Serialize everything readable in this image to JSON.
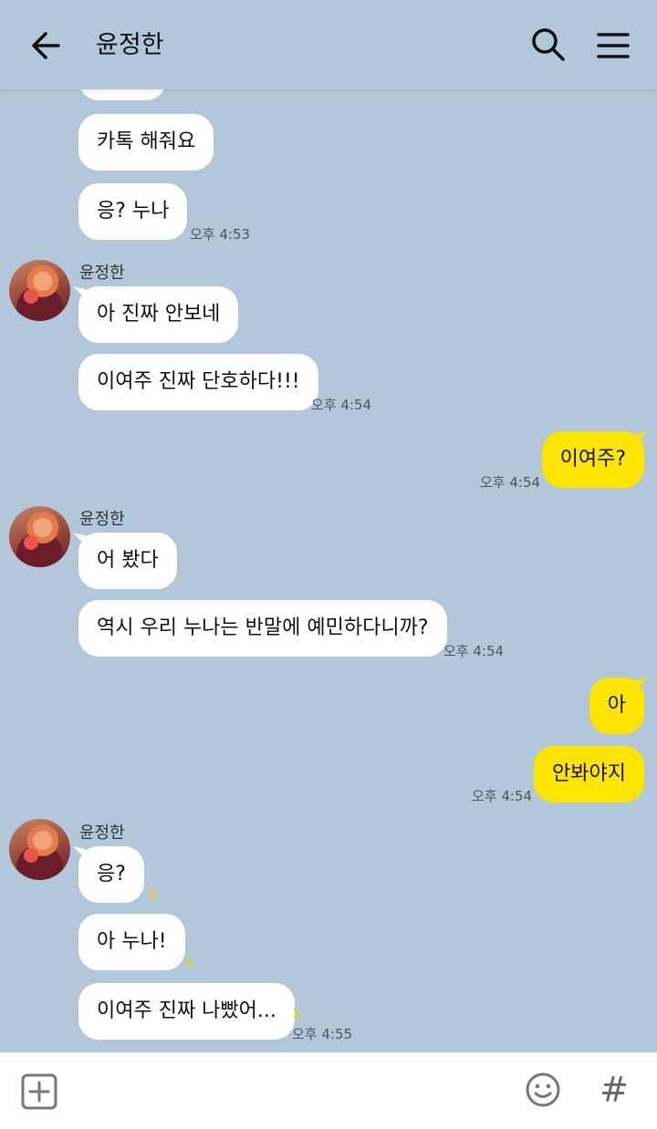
{
  "header": {
    "title": "윤정한"
  },
  "icons": {
    "back": "arrow-left-icon",
    "search": "search-icon",
    "menu": "hamburger-menu-icon",
    "add": "plus-square-icon",
    "emoji": "smiley-icon",
    "hashtag": "hash-icon"
  },
  "colors": {
    "background": "#b2c7d9",
    "incoming": "#ffffff",
    "outgoing": "#fee500",
    "unread": "#e6d21a"
  },
  "sender_name": "윤정한",
  "messages": {
    "m2": "카톡 해줘요",
    "m3": "응? 누나",
    "t1": "오후 4:53",
    "m4": "아 진짜 안보네",
    "m5": "이여주 진짜 단호하다!!!",
    "t2": "오후 4:54",
    "m6": "이여주?",
    "t3": "오후 4:54",
    "m7": "어 봤다",
    "m8": "역시 우리 누나는 반말에 예민하다니까?",
    "t4": "오후 4:54",
    "m9": "아",
    "m10": "안봐야지",
    "t5": "오후 4:54",
    "m11": "응?",
    "m12": "아 누나!",
    "m13": "이여주 진짜 나빴어...",
    "t6": "오후 4:55",
    "unread_count": "1"
  },
  "footer": {
    "hash_symbol": "#"
  }
}
